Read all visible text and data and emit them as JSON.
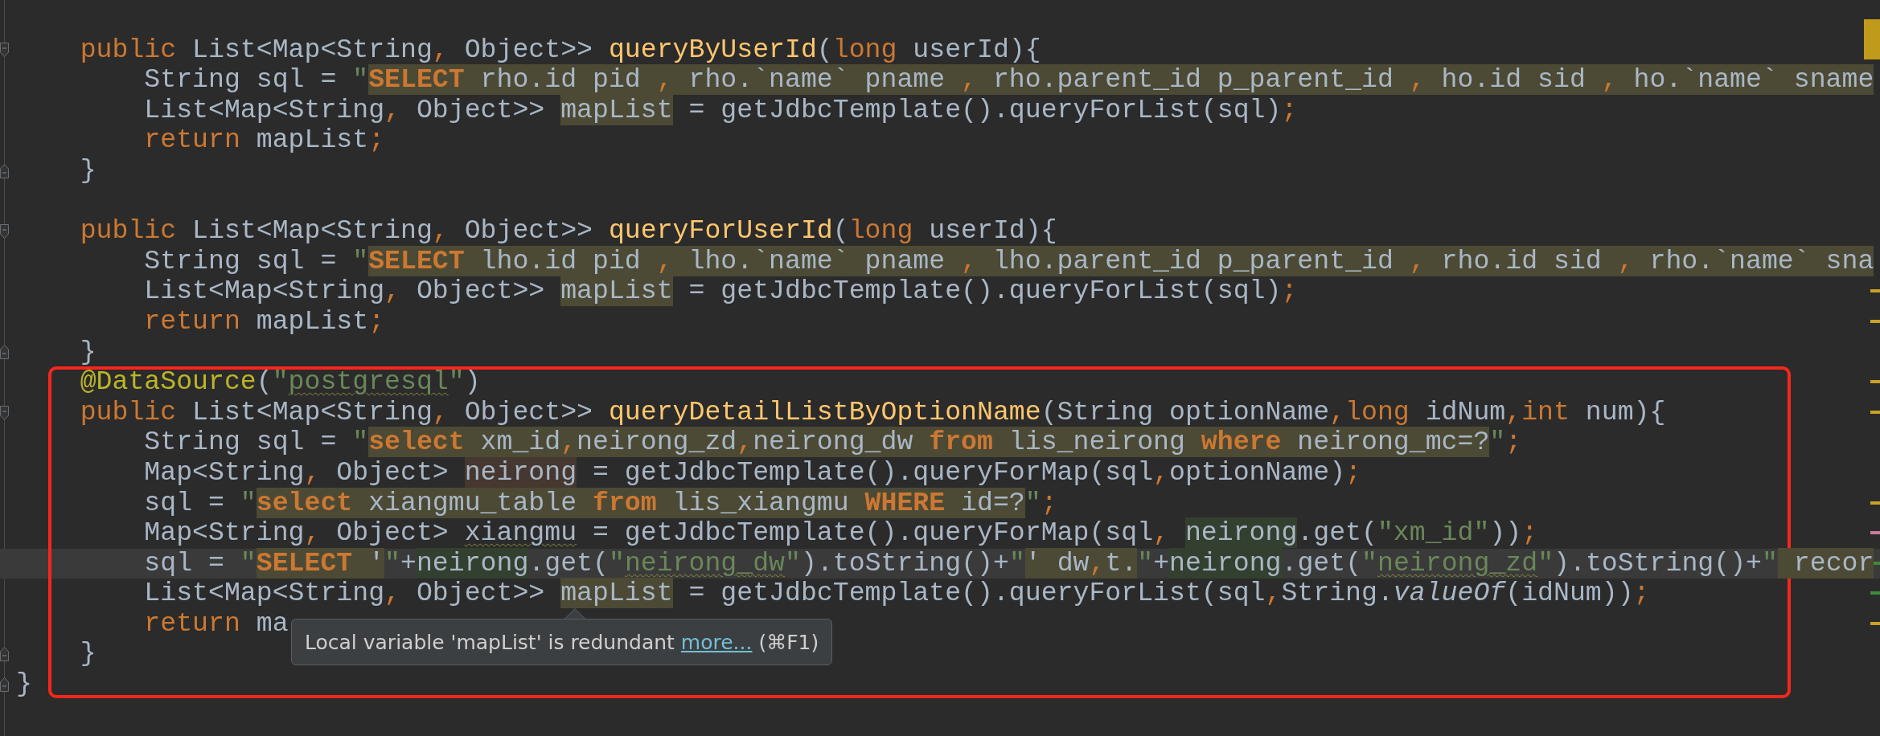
{
  "editor": {
    "lines": [
      {
        "current": false,
        "fold_open": false,
        "fold_close": false
      },
      {
        "current": false,
        "fold_open": true,
        "fold_close": false,
        "tokens": [
          {
            "kind": "kw",
            "text": "    public "
          },
          {
            "kind": "p",
            "text": "List<Map<String"
          },
          {
            "kind": "kw",
            "text": ", "
          },
          {
            "kind": "p",
            "text": "Object>> "
          },
          {
            "kind": "fn",
            "text": "queryByUserId"
          },
          {
            "kind": "p",
            "text": "("
          },
          {
            "kind": "kw",
            "text": "long "
          },
          {
            "kind": "p",
            "text": "userId){"
          }
        ]
      },
      {
        "current": false,
        "fold_open": false,
        "fold_close": false,
        "tokens": [
          {
            "kind": "p",
            "text": "        String sql = "
          },
          {
            "kind": "s",
            "text": "\""
          },
          {
            "kind": "qk",
            "text": "SELECT"
          },
          {
            "kind": "q",
            "text": " rho.id pid "
          },
          {
            "kind": "qp",
            "text": ","
          },
          {
            "kind": "q",
            "text": " rho.`name` pname "
          },
          {
            "kind": "qp",
            "text": ","
          },
          {
            "kind": "q",
            "text": " rho.parent_id p_parent_id "
          },
          {
            "kind": "qp",
            "text": ","
          },
          {
            "kind": "q",
            "text": " ho.id sid "
          },
          {
            "kind": "qp",
            "text": ","
          },
          {
            "kind": "q",
            "text": " ho.`name` sname"
          }
        ]
      },
      {
        "current": false,
        "fold_open": false,
        "fold_close": false,
        "tokens": [
          {
            "kind": "p",
            "text": "        List<Map<String"
          },
          {
            "kind": "kw",
            "text": ", "
          },
          {
            "kind": "p",
            "text": "Object>> "
          },
          {
            "kind": "v",
            "text": "mapList"
          },
          {
            "kind": "p",
            "text": " = getJdbcTemplate().queryForList(sql)"
          },
          {
            "kind": "kw",
            "text": ";"
          }
        ]
      },
      {
        "current": false,
        "fold_open": false,
        "fold_close": false,
        "tokens": [
          {
            "kind": "kw",
            "text": "        return "
          },
          {
            "kind": "p",
            "text": "mapList"
          },
          {
            "kind": "kw",
            "text": ";"
          }
        ]
      },
      {
        "current": false,
        "fold_open": false,
        "fold_close": true,
        "tokens": [
          {
            "kind": "p",
            "text": "    }"
          }
        ]
      },
      {
        "current": false,
        "fold_open": false,
        "fold_close": false
      },
      {
        "current": false,
        "fold_open": true,
        "fold_close": false,
        "tokens": [
          {
            "kind": "kw",
            "text": "    public "
          },
          {
            "kind": "p",
            "text": "List<Map<String"
          },
          {
            "kind": "kw",
            "text": ", "
          },
          {
            "kind": "p",
            "text": "Object>> "
          },
          {
            "kind": "fn",
            "text": "queryForUserId"
          },
          {
            "kind": "p",
            "text": "("
          },
          {
            "kind": "kw",
            "text": "long "
          },
          {
            "kind": "p",
            "text": "userId){"
          }
        ]
      },
      {
        "current": false,
        "fold_open": false,
        "fold_close": false,
        "tokens": [
          {
            "kind": "p",
            "text": "        String sql = "
          },
          {
            "kind": "s",
            "text": "\""
          },
          {
            "kind": "qk",
            "text": "SELECT"
          },
          {
            "kind": "q",
            "text": " lho.id pid "
          },
          {
            "kind": "qp",
            "text": ","
          },
          {
            "kind": "q",
            "text": " lho.`name` pname "
          },
          {
            "kind": "qp",
            "text": ","
          },
          {
            "kind": "q",
            "text": " lho.parent_id p_parent_id "
          },
          {
            "kind": "qp",
            "text": ","
          },
          {
            "kind": "q",
            "text": " rho.id sid "
          },
          {
            "kind": "qp",
            "text": ","
          },
          {
            "kind": "q",
            "text": " rho.`name` sna"
          }
        ]
      },
      {
        "current": false,
        "fold_open": false,
        "fold_close": false,
        "marker": {
          "color": "#c9a227"
        },
        "tokens": [
          {
            "kind": "p",
            "text": "        List<Map<String"
          },
          {
            "kind": "kw",
            "text": ", "
          },
          {
            "kind": "p",
            "text": "Object>> "
          },
          {
            "kind": "v",
            "text": "mapList"
          },
          {
            "kind": "p",
            "text": " = getJdbcTemplate().queryForList(sql)"
          },
          {
            "kind": "kw",
            "text": ";"
          }
        ]
      },
      {
        "current": false,
        "fold_open": false,
        "fold_close": false,
        "marker": {
          "color": "#c9a227"
        },
        "tokens": [
          {
            "kind": "kw",
            "text": "        return "
          },
          {
            "kind": "p",
            "text": "mapList"
          },
          {
            "kind": "kw",
            "text": ";"
          }
        ]
      },
      {
        "current": false,
        "fold_open": false,
        "fold_close": true,
        "tokens": [
          {
            "kind": "p",
            "text": "    }"
          }
        ]
      },
      {
        "current": false,
        "fold_open": false,
        "fold_close": false,
        "marker": {
          "color": "#c9a227"
        },
        "tokens": [
          {
            "kind": "an",
            "text": "    @DataSource"
          },
          {
            "kind": "p",
            "text": "("
          },
          {
            "kind": "s",
            "text": "\""
          },
          {
            "kind": "sw",
            "text": "postgresql"
          },
          {
            "kind": "s",
            "text": "\""
          },
          {
            "kind": "p",
            "text": ")"
          }
        ]
      },
      {
        "current": false,
        "fold_open": true,
        "fold_close": false,
        "marker": {
          "color": "#c9a227"
        },
        "tokens": [
          {
            "kind": "kw",
            "text": "    public "
          },
          {
            "kind": "p",
            "text": "List<Map<String"
          },
          {
            "kind": "kw",
            "text": ", "
          },
          {
            "kind": "p",
            "text": "Object>> "
          },
          {
            "kind": "fn",
            "text": "queryDetailListByOptionName"
          },
          {
            "kind": "p",
            "text": "(String optionName"
          },
          {
            "kind": "kw",
            "text": ",long "
          },
          {
            "kind": "p",
            "text": "idNum"
          },
          {
            "kind": "kw",
            "text": ",int "
          },
          {
            "kind": "p",
            "text": "num){"
          }
        ]
      },
      {
        "current": false,
        "fold_open": false,
        "fold_close": false,
        "tokens": [
          {
            "kind": "p",
            "text": "        String sql = "
          },
          {
            "kind": "s",
            "text": "\""
          },
          {
            "kind": "qk",
            "text": "select"
          },
          {
            "kind": "q",
            "text": " xm_id"
          },
          {
            "kind": "qp",
            "text": ","
          },
          {
            "kind": "q",
            "text": "neirong_zd"
          },
          {
            "kind": "qp",
            "text": ","
          },
          {
            "kind": "q",
            "text": "neirong_dw "
          },
          {
            "kind": "qk",
            "text": "from"
          },
          {
            "kind": "q",
            "text": " lis_neirong "
          },
          {
            "kind": "qk",
            "text": "where"
          },
          {
            "kind": "q",
            "text": " neirong_mc=?"
          },
          {
            "kind": "s",
            "text": "\""
          },
          {
            "kind": "kw",
            "text": ";"
          }
        ]
      },
      {
        "current": false,
        "fold_open": false,
        "fold_close": false,
        "tokens": [
          {
            "kind": "p",
            "text": "        Map<String"
          },
          {
            "kind": "kw",
            "text": ", "
          },
          {
            "kind": "p",
            "text": "Object> "
          },
          {
            "kind": "vw",
            "text": "neirong"
          },
          {
            "kind": "p",
            "text": " = getJdbcTemplate().queryForMap(sql"
          },
          {
            "kind": "kw",
            "text": ","
          },
          {
            "kind": "p",
            "text": "optionName)"
          },
          {
            "kind": "kw",
            "text": ";"
          }
        ]
      },
      {
        "current": false,
        "fold_open": false,
        "fold_close": false,
        "marker": {
          "color": "#c9a227"
        },
        "tokens": [
          {
            "kind": "p",
            "text": "        sql = "
          },
          {
            "kind": "s",
            "text": "\""
          },
          {
            "kind": "qk",
            "text": "select"
          },
          {
            "kind": "q",
            "text": " xiangmu_table "
          },
          {
            "kind": "qk",
            "text": "from"
          },
          {
            "kind": "q",
            "text": " lis_xiangmu "
          },
          {
            "kind": "qk",
            "text": "WHERE"
          },
          {
            "kind": "q",
            "text": " id=?"
          },
          {
            "kind": "s",
            "text": "\""
          },
          {
            "kind": "kw",
            "text": ";"
          }
        ]
      },
      {
        "current": false,
        "fold_open": false,
        "fold_close": false,
        "marker": {
          "color": "#c77b9a"
        },
        "tokens": [
          {
            "kind": "p",
            "text": "        Map<String"
          },
          {
            "kind": "kw",
            "text": ", "
          },
          {
            "kind": "p",
            "text": "Object> "
          },
          {
            "kind": "vu",
            "text": "xiangmu"
          },
          {
            "kind": "p",
            "text": " = getJdbcTemplate().queryForMap(sql"
          },
          {
            "kind": "kw",
            "text": ", "
          },
          {
            "kind": "vr",
            "text": "neirong"
          },
          {
            "kind": "p",
            "text": ".get("
          },
          {
            "kind": "s",
            "text": "\"xm_id\""
          },
          {
            "kind": "p",
            "text": "))"
          },
          {
            "kind": "kw",
            "text": ";"
          }
        ]
      },
      {
        "current": true,
        "fold_open": false,
        "fold_close": false,
        "marker": {
          "color": "#3c8c3c"
        },
        "tokens": [
          {
            "kind": "p",
            "text": "        sql = "
          },
          {
            "kind": "s",
            "text": "\""
          },
          {
            "kind": "qk",
            "text": "SELECT"
          },
          {
            "kind": "q",
            "text": " '"
          },
          {
            "kind": "s",
            "text": "\""
          },
          {
            "kind": "p",
            "text": "+"
          },
          {
            "kind": "vr",
            "text": "neirong"
          },
          {
            "kind": "p",
            "text": ".get("
          },
          {
            "kind": "s",
            "text": "\""
          },
          {
            "kind": "sw",
            "text": "neirong_dw"
          },
          {
            "kind": "s",
            "text": "\""
          },
          {
            "kind": "p",
            "text": ").toString()+"
          },
          {
            "kind": "s",
            "text": "\""
          },
          {
            "kind": "q",
            "text": "' dw"
          },
          {
            "kind": "qp",
            "text": ","
          },
          {
            "kind": "q",
            "text": "t."
          },
          {
            "kind": "s",
            "text": "\""
          },
          {
            "kind": "p",
            "text": "+"
          },
          {
            "kind": "vr",
            "text": "neirong"
          },
          {
            "kind": "p",
            "text": ".get("
          },
          {
            "kind": "s",
            "text": "\""
          },
          {
            "kind": "sw",
            "text": "neirong_zd"
          },
          {
            "kind": "s",
            "text": "\""
          },
          {
            "kind": "p",
            "text": ").toString()+"
          },
          {
            "kind": "s",
            "text": "\""
          },
          {
            "kind": "q",
            "text": " recor"
          }
        ]
      },
      {
        "current": false,
        "fold_open": false,
        "fold_close": false,
        "marker": {
          "color": "#3c8c3c"
        },
        "tokens": [
          {
            "kind": "p",
            "text": "        List<Map<String"
          },
          {
            "kind": "kw",
            "text": ", "
          },
          {
            "kind": "p",
            "text": "Object>> "
          },
          {
            "kind": "v",
            "text": "mapList"
          },
          {
            "kind": "p",
            "text": " = getJdbcTemplate().queryForList(sql"
          },
          {
            "kind": "kw",
            "text": ","
          },
          {
            "kind": "p",
            "text": "String."
          },
          {
            "kind": "i",
            "text": "valueOf"
          },
          {
            "kind": "p",
            "text": "(idNum))"
          },
          {
            "kind": "kw",
            "text": ";"
          }
        ]
      },
      {
        "current": false,
        "fold_open": false,
        "fold_close": false,
        "marker": {
          "color": "#c9a227"
        },
        "tokens": [
          {
            "kind": "kw",
            "text": "        return "
          },
          {
            "kind": "p",
            "text": "ma"
          }
        ]
      },
      {
        "current": false,
        "fold_open": false,
        "fold_close": true,
        "tokens": [
          {
            "kind": "p",
            "text": "    }"
          }
        ]
      },
      {
        "current": false,
        "fold_open": false,
        "fold_close": true,
        "tokens": [
          {
            "kind": "p",
            "text": "}"
          }
        ]
      }
    ]
  },
  "tooltip": {
    "message": "Local variable 'mapList' is redundant",
    "link": "more...",
    "shortcut": "(⌘F1)"
  }
}
